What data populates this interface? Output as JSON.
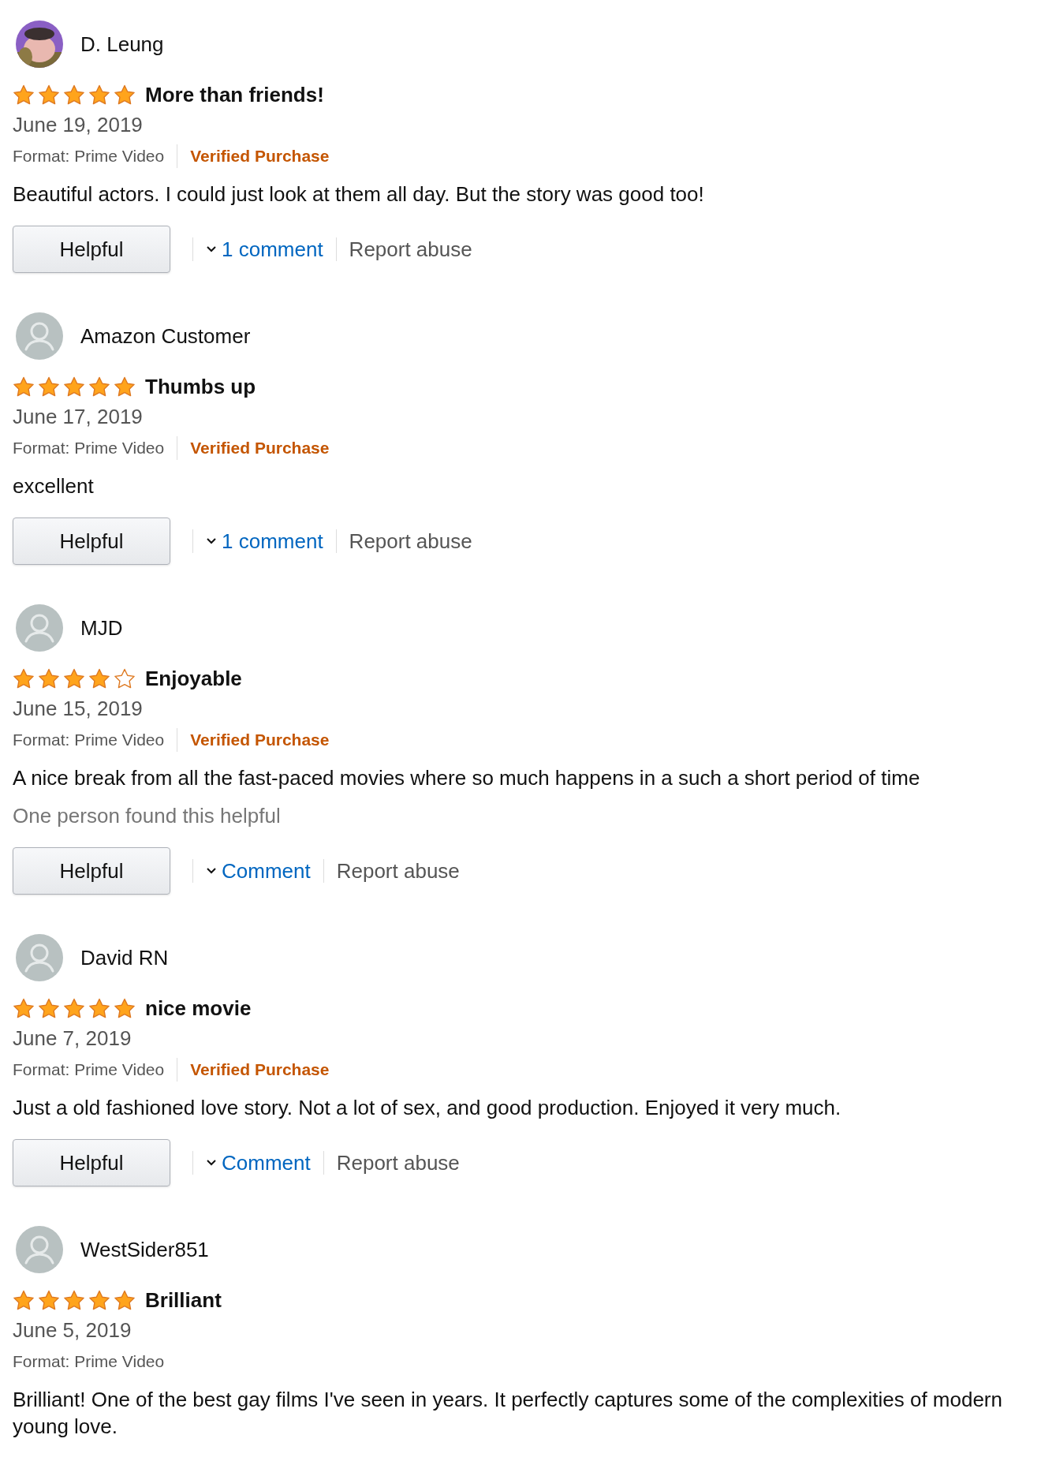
{
  "reviews": [
    {
      "reviewer": "D. Leung",
      "stars": 5,
      "title": "More than friends!",
      "date": "June 19, 2019",
      "format": "Format: Prime Video",
      "badge": "Verified Purchase",
      "body": "Beautiful actors. I could just look at them all day. But the story was good too!",
      "helpful_button": "Helpful",
      "comment_link": "1 comment",
      "report_link": "Report abuse"
    },
    {
      "reviewer": "Amazon Customer",
      "avatar": {
        "kind": "default"
      },
      "stars": 5,
      "title": "Thumbs up",
      "date": "June 17, 2019",
      "format": "Format: Prime Video",
      "badge": "Verified Purchase",
      "body": "excellent",
      "helpful_button": "Helpful",
      "comment_link": "1 comment",
      "report_link": "Report abuse"
    },
    {
      "reviewer": "MJD",
      "avatar": {
        "kind": "default"
      },
      "stars": 4,
      "title": "Enjoyable",
      "date": "June 15, 2019",
      "format": "Format: Prime Video",
      "badge": "Verified Purchase",
      "body": "A nice break from all the fast-paced movies where so much happens in a such a short period of time",
      "helpful_count": "One person found this helpful",
      "helpful_button": "Helpful",
      "comment_link": "Comment",
      "report_link": "Report abuse"
    },
    {
      "reviewer": "David RN",
      "avatar": {
        "kind": "default"
      },
      "stars": 5,
      "title": "nice movie",
      "date": "June 7, 2019",
      "format": "Format: Prime Video",
      "badge": "Verified Purchase",
      "body": "Just a old fashioned love story. Not a lot of sex, and good production. Enjoyed it very much.",
      "helpful_button": "Helpful",
      "comment_link": "Comment",
      "report_link": "Report abuse"
    },
    {
      "reviewer": "WestSider851",
      "avatar": {
        "kind": "default"
      },
      "stars": 5,
      "title": "Brilliant",
      "date": "June 5, 2019",
      "format": "Format: Prime Video",
      "body": "Brilliant! One of the best gay films I've seen in years. It perfectly captures some of the complexities of modern young love."
    }
  ]
}
